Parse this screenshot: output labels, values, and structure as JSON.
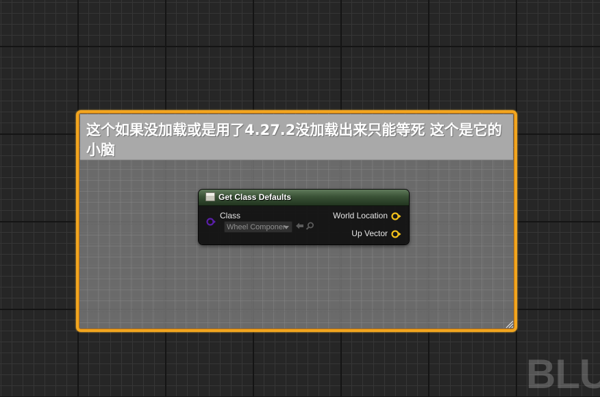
{
  "comment_box": {
    "text": "这个如果没加载或是用了4.27.2没加载出来只能等死 这个是它的小脑"
  },
  "node": {
    "title": "Get Class Defaults",
    "header_color": "#3a5236",
    "inputs": [
      {
        "label": "Class",
        "value": "Wheel Componer",
        "pin_color": "#5a1fa8"
      }
    ],
    "outputs": [
      {
        "label": "World Location",
        "pin_color": "#f2c01a"
      },
      {
        "label": "Up Vector",
        "pin_color": "#f2c01a"
      }
    ]
  },
  "watermark": {
    "text": "BLU"
  },
  "colors": {
    "comment_border": "#f2a51f",
    "comment_header": "#a9a9a9",
    "graph_background": "#262626"
  }
}
